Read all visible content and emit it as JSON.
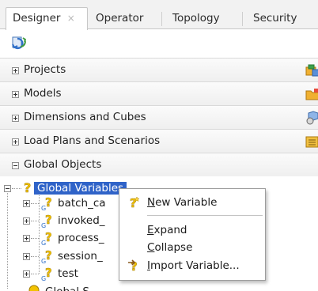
{
  "tabs": [
    {
      "label": "Designer",
      "active": true,
      "close": "×"
    },
    {
      "label": "Operator"
    },
    {
      "label": "Topology"
    },
    {
      "label": "Security"
    }
  ],
  "toolbar": {
    "refresh_icon": "refresh-icon"
  },
  "sections": [
    {
      "label": "Projects",
      "expander": "+",
      "icon": "projects-icon"
    },
    {
      "label": "Models",
      "expander": "+",
      "icon": "models-icon"
    },
    {
      "label": "Dimensions and Cubes",
      "expander": "+",
      "icon": "cubes-icon"
    },
    {
      "label": "Load Plans and Scenarios",
      "expander": "+",
      "icon": "loadplans-icon"
    },
    {
      "label": "Global Objects",
      "expander": "−"
    }
  ],
  "tree": {
    "root": {
      "label": "Global Variables",
      "selected": true
    },
    "children": [
      "batch_ca",
      "invoked_",
      "process_",
      "session_",
      "test"
    ],
    "next_partial": "Global S"
  },
  "context_menu": {
    "items": [
      {
        "label": "New Variable",
        "mnemonic": "N",
        "icon": "variable-icon"
      },
      {
        "label": "Expand",
        "mnemonic": "E"
      },
      {
        "label": "Collapse",
        "mnemonic": "C"
      },
      {
        "label": "Import Variable...",
        "mnemonic": "I",
        "icon": "import-variable-icon"
      }
    ]
  },
  "colors": {
    "selection": "#2f63c8",
    "variable_icon": "#f2c200"
  }
}
